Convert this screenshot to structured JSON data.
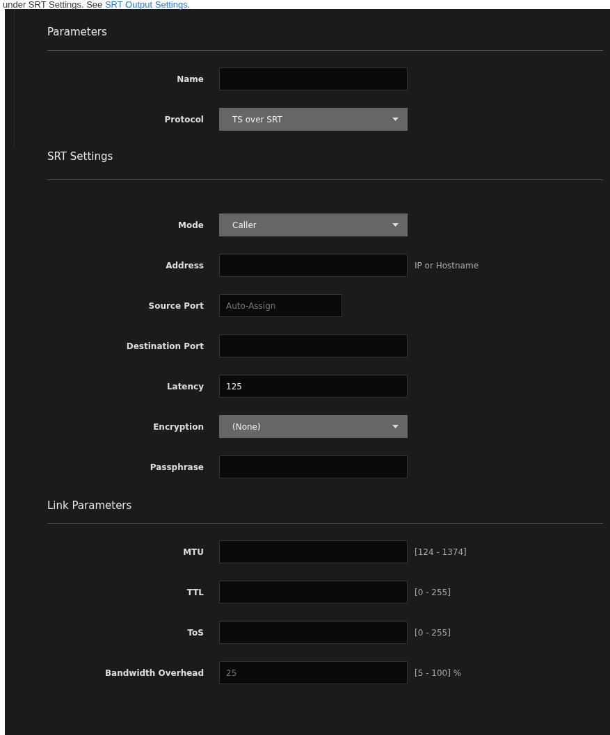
{
  "intro": {
    "text": "under SRT Settings. See ",
    "link": "SRT Output Settings",
    "after": "."
  },
  "sections": [
    {
      "title": "Parameters",
      "fields": [
        {
          "kind": "text",
          "label": "Name"
        },
        {
          "kind": "select",
          "label": "Protocol",
          "value": "TS over SRT"
        }
      ]
    },
    {
      "title": "SRT Settings",
      "fields": [
        {
          "kind": "select",
          "label": "Mode",
          "value": "Caller"
        },
        {
          "kind": "text",
          "label": "Address",
          "hint": "IP or Hostname"
        },
        {
          "kind": "text",
          "label": "Source Port",
          "placeholder": "Auto-Assign",
          "short": true
        },
        {
          "kind": "text",
          "label": "Destination Port"
        },
        {
          "kind": "text",
          "label": "Latency",
          "value": "125"
        },
        {
          "kind": "select",
          "label": "Encryption",
          "value": "(None)"
        },
        {
          "kind": "text",
          "label": "Passphrase"
        }
      ]
    },
    {
      "title": "Link Parameters",
      "fields": [
        {
          "kind": "text",
          "label": "MTU",
          "hint": "[124 - 1374]"
        },
        {
          "kind": "text",
          "label": "TTL",
          "hint": "[0 - 255]"
        },
        {
          "kind": "text",
          "label": "ToS",
          "hint": "[0 - 255]"
        },
        {
          "kind": "text",
          "label": "Bandwidth Overhead",
          "placeholder": "25",
          "hint": "[5 - 100] %"
        }
      ]
    }
  ]
}
